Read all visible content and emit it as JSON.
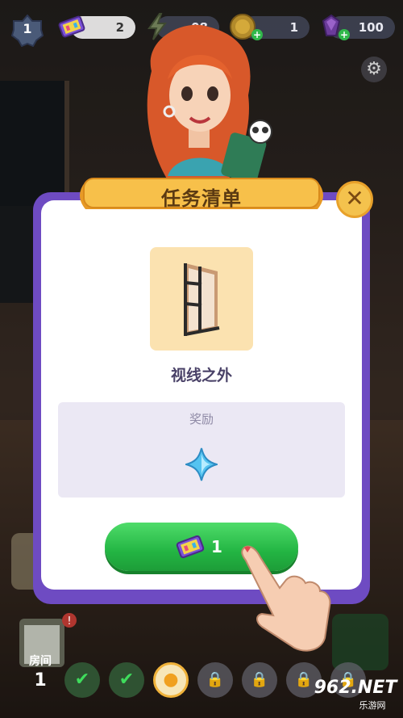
{
  "topbar": {
    "level": "1",
    "tickets": "2",
    "energy": "08",
    "coins": "1",
    "gems": "100"
  },
  "dialog": {
    "title": "任务清单",
    "close_label": "✕",
    "task_name": "视线之外",
    "reward_label": "奖励",
    "go_count": "1"
  },
  "bottom_bar": {
    "room_label": "房间",
    "room_number": "1",
    "stages": [
      {
        "state": "done",
        "symbol": "✔"
      },
      {
        "state": "done",
        "symbol": "✔"
      },
      {
        "state": "current",
        "symbol": "●"
      },
      {
        "state": "locked",
        "symbol": "🔒"
      },
      {
        "state": "locked",
        "symbol": "🔒"
      },
      {
        "state": "locked",
        "symbol": "🔒"
      },
      {
        "state": "locked",
        "symbol": "🔒"
      }
    ]
  },
  "watermark": {
    "text": "962.NET",
    "sub": "乐游网"
  },
  "colors": {
    "dialog_frame": "#6e4bc2",
    "button_green": "#23b543",
    "ribbon_gold": "#f7c04a"
  },
  "icons": [
    "level-star-icon",
    "ticket-icon",
    "energy-icon",
    "coin-icon",
    "gem-icon",
    "gear-icon",
    "close-icon",
    "window-icon",
    "diamond-icon",
    "lock-icon",
    "checkmark-icon",
    "location-pin-icon"
  ]
}
